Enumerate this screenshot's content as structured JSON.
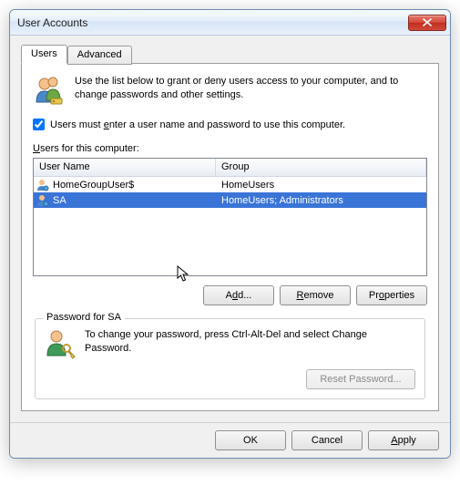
{
  "window": {
    "title": "User Accounts"
  },
  "tabs": {
    "users": "Users",
    "advanced": "Advanced"
  },
  "intro": "Use the list below to grant or deny users access to your computer, and to change passwords and other settings.",
  "checkbox": {
    "prefix": "Users must ",
    "underlined": "e",
    "suffix": "nter a user name and password to use this computer.",
    "checked": true
  },
  "list_label": {
    "prefix": "",
    "underlined": "U",
    "suffix": "sers for this computer:"
  },
  "columns": {
    "name": "User Name",
    "group": "Group"
  },
  "users": [
    {
      "name": "HomeGroupUser$",
      "group": "HomeUsers",
      "selected": false
    },
    {
      "name": "SA",
      "group": "HomeUsers; Administrators",
      "selected": true
    }
  ],
  "buttons": {
    "add": {
      "prefix": "A",
      "underlined": "d",
      "suffix": "d..."
    },
    "remove": {
      "prefix": "",
      "underlined": "R",
      "suffix": "emove"
    },
    "properties": {
      "prefix": "Pr",
      "underlined": "o",
      "suffix": "perties"
    },
    "reset": {
      "label": "Reset Password..."
    },
    "ok": "OK",
    "cancel": "Cancel",
    "apply": {
      "prefix": "",
      "underlined": "A",
      "suffix": "pply"
    }
  },
  "password_group": {
    "legend": "Password for SA",
    "text": "To change your password, press Ctrl-Alt-Del and select Change Password."
  }
}
